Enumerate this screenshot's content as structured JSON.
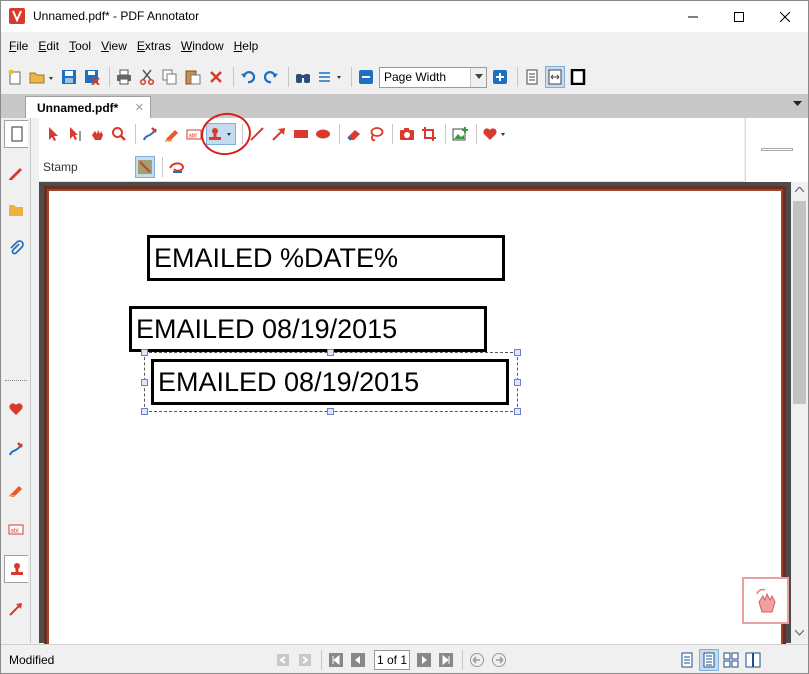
{
  "window": {
    "title": "Unnamed.pdf* - PDF Annotator",
    "minimize": "minimize",
    "maximize": "maximize",
    "close": "close"
  },
  "menu": {
    "items": [
      {
        "key": "F",
        "rest": "ile"
      },
      {
        "key": "E",
        "rest": "dit"
      },
      {
        "key": "T",
        "rest": "ool"
      },
      {
        "key": "V",
        "rest": "iew"
      },
      {
        "key": "E",
        "rest": "xtras"
      },
      {
        "key": "W",
        "rest": "indow"
      },
      {
        "key": "H",
        "rest": "elp"
      }
    ]
  },
  "toolbar": {
    "zoom_value": "Page Width"
  },
  "tabs": {
    "active": "Unnamed.pdf*"
  },
  "annotation_toolbar": {
    "active_tool_label": "Stamp"
  },
  "document": {
    "stamps": [
      "EMAILED %DATE%",
      "EMAILED 08/19/2015",
      "EMAILED 08/19/2015"
    ]
  },
  "status": {
    "text": "Modified",
    "page_indicator": "1 of 1"
  },
  "colors": {
    "accent_red": "#d83b2b",
    "accent_blue": "#1e6fc0",
    "page_border": "#a0442a",
    "doc_background": "#4c4c4c"
  }
}
